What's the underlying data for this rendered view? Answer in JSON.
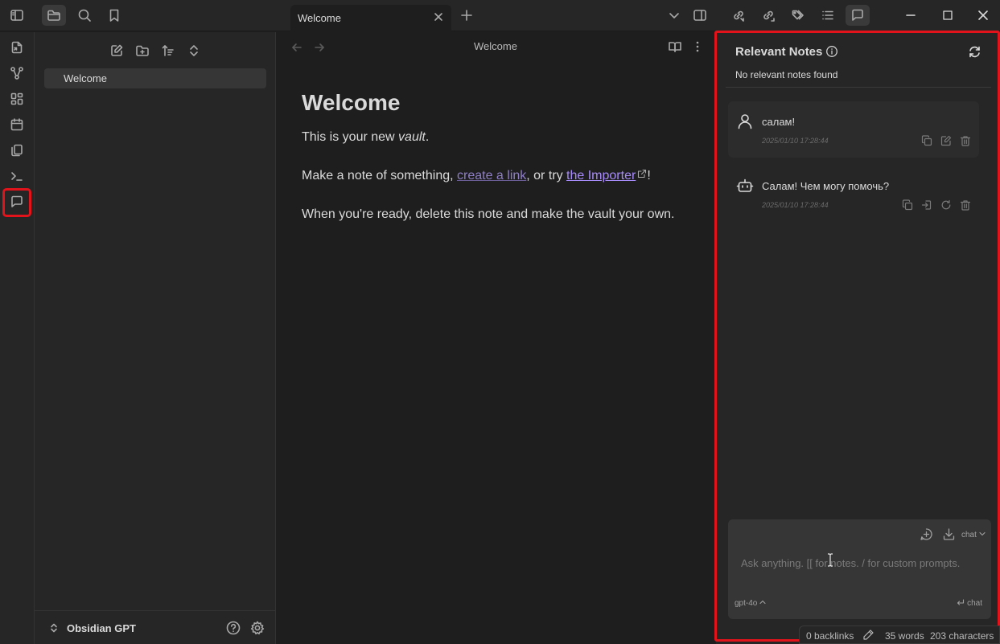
{
  "titlebar": {
    "tabs": [
      {
        "label": "Welcome"
      }
    ],
    "icons": [
      "sidebar-toggle-icon",
      "folder-icon",
      "search-icon",
      "bookmark-icon",
      "plus-icon",
      "chevron-down-icon",
      "right-sidebar-icon",
      "backlinks-icon",
      "outgoing-links-icon",
      "tags-icon",
      "outline-icon",
      "chat-icon",
      "minimize-icon",
      "maximize-icon",
      "close-icon"
    ]
  },
  "ribbon": {
    "icons": [
      "open-quick-switcher-icon",
      "graph-view-icon",
      "canvas-icon",
      "daily-note-icon",
      "templates-icon",
      "command-palette-icon",
      "copilot-chat-icon"
    ]
  },
  "explorer": {
    "files": [
      {
        "label": "Welcome"
      }
    ],
    "vault_name": "Obsidian GPT"
  },
  "editor": {
    "title": "Welcome",
    "heading": "Welcome",
    "p1_prefix": "This is your new ",
    "p1_em": "vault",
    "p1_suffix": ".",
    "p2_prefix": "Make a note of something, ",
    "p2_link1": "create a link",
    "p2_mid": ", or try ",
    "p2_link2": "the Importer",
    "p2_suffix": "!",
    "p3": "When you're ready, delete this note and make the vault your own."
  },
  "copilot": {
    "relevant_title": "Relevant Notes",
    "relevant_empty": "No relevant notes found",
    "messages": [
      {
        "role": "user",
        "text": "салам!",
        "time": "2025/01/10 17:28:44"
      },
      {
        "role": "ai",
        "text": "Салам! Чем могу помочь?",
        "time": "2025/01/10 17:28:44"
      }
    ],
    "input_placeholder": "Ask anything. [[ for notes. / for custom prompts.",
    "mode": "chat",
    "model": "gpt-4o",
    "send_label": "chat"
  },
  "status": {
    "backlinks": "0 backlinks",
    "words": "35 words",
    "characters": "203 characters"
  },
  "colors": {
    "accent": "#a88bfa",
    "highlight": "#e3131b"
  }
}
